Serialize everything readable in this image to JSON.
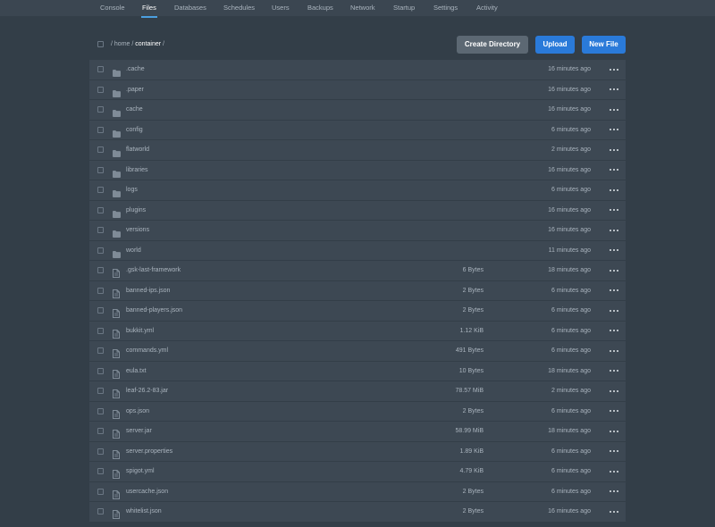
{
  "nav": {
    "tabs": [
      {
        "label": "Console",
        "active": false
      },
      {
        "label": "Files",
        "active": true
      },
      {
        "label": "Databases",
        "active": false
      },
      {
        "label": "Schedules",
        "active": false
      },
      {
        "label": "Users",
        "active": false
      },
      {
        "label": "Backups",
        "active": false
      },
      {
        "label": "Network",
        "active": false
      },
      {
        "label": "Startup",
        "active": false
      },
      {
        "label": "Settings",
        "active": false
      },
      {
        "label": "Activity",
        "active": false
      }
    ]
  },
  "breadcrumb": {
    "sep1": "/",
    "home": "home",
    "sep2": "/",
    "current": "container",
    "sep3": "/"
  },
  "actions": {
    "create_directory": "Create Directory",
    "upload": "Upload",
    "new_file": "New File"
  },
  "colors": {
    "accent": "#2a7ad9",
    "background": "#333e48",
    "row": "#3d4853"
  },
  "files": [
    {
      "type": "folder",
      "name": ".cache",
      "size": "",
      "modified": "16 minutes ago"
    },
    {
      "type": "folder",
      "name": ".paper",
      "size": "",
      "modified": "16 minutes ago"
    },
    {
      "type": "folder",
      "name": "cache",
      "size": "",
      "modified": "16 minutes ago"
    },
    {
      "type": "folder",
      "name": "config",
      "size": "",
      "modified": "6 minutes ago"
    },
    {
      "type": "folder",
      "name": "flatworld",
      "size": "",
      "modified": "2 minutes ago"
    },
    {
      "type": "folder",
      "name": "libraries",
      "size": "",
      "modified": "16 minutes ago"
    },
    {
      "type": "folder",
      "name": "logs",
      "size": "",
      "modified": "6 minutes ago"
    },
    {
      "type": "folder",
      "name": "plugins",
      "size": "",
      "modified": "16 minutes ago"
    },
    {
      "type": "folder",
      "name": "versions",
      "size": "",
      "modified": "16 minutes ago"
    },
    {
      "type": "folder",
      "name": "world",
      "size": "",
      "modified": "11 minutes ago"
    },
    {
      "type": "file",
      "name": ".gsk-last-framework",
      "size": "6 Bytes",
      "modified": "18 minutes ago"
    },
    {
      "type": "file",
      "name": "banned-ips.json",
      "size": "2 Bytes",
      "modified": "6 minutes ago"
    },
    {
      "type": "file",
      "name": "banned-players.json",
      "size": "2 Bytes",
      "modified": "6 minutes ago"
    },
    {
      "type": "file",
      "name": "bukkit.yml",
      "size": "1.12 KiB",
      "modified": "6 minutes ago"
    },
    {
      "type": "file",
      "name": "commands.yml",
      "size": "491 Bytes",
      "modified": "6 minutes ago"
    },
    {
      "type": "file",
      "name": "eula.txt",
      "size": "10 Bytes",
      "modified": "18 minutes ago"
    },
    {
      "type": "file",
      "name": "leaf-26.2-83.jar",
      "size": "78.57 MiB",
      "modified": "2 minutes ago"
    },
    {
      "type": "file",
      "name": "ops.json",
      "size": "2 Bytes",
      "modified": "6 minutes ago"
    },
    {
      "type": "file",
      "name": "server.jar",
      "size": "58.99 MiB",
      "modified": "18 minutes ago"
    },
    {
      "type": "file",
      "name": "server.properties",
      "size": "1.89 KiB",
      "modified": "6 minutes ago"
    },
    {
      "type": "file",
      "name": "spigot.yml",
      "size": "4.79 KiB",
      "modified": "6 minutes ago"
    },
    {
      "type": "file",
      "name": "usercache.json",
      "size": "2 Bytes",
      "modified": "6 minutes ago"
    },
    {
      "type": "file",
      "name": "whitelist.json",
      "size": "2 Bytes",
      "modified": "16 minutes ago"
    }
  ]
}
